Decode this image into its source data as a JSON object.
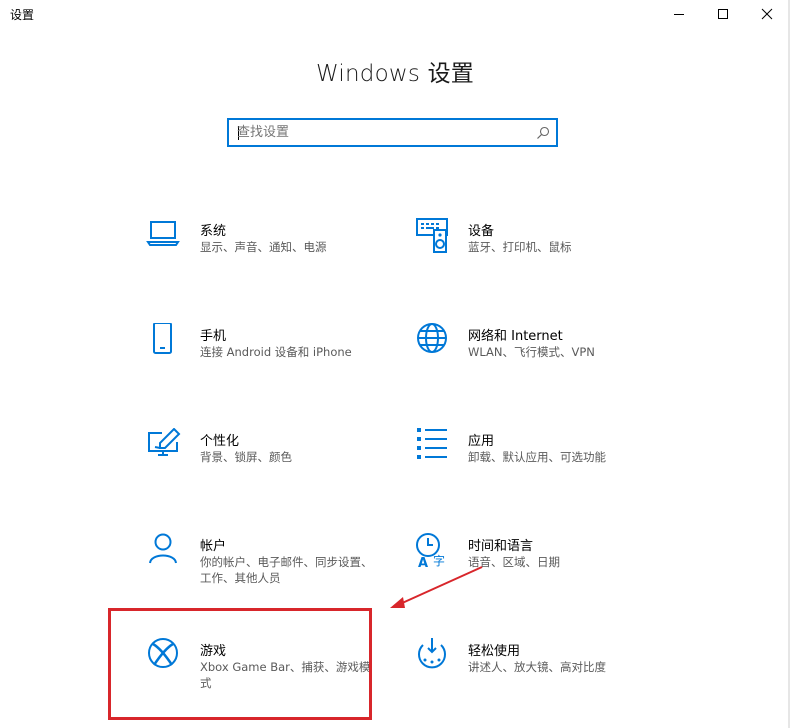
{
  "window": {
    "title": "设置",
    "minimize_icon": "minimize-icon",
    "maximize_icon": "maximize-icon",
    "close_icon": "close-icon"
  },
  "header": {
    "title": "Windows 设置"
  },
  "search": {
    "placeholder": "查找设置",
    "value": "",
    "icon": "search-icon"
  },
  "categories": [
    {
      "name": "系统",
      "desc": "显示、声音、通知、电源",
      "icon": "laptop-icon"
    },
    {
      "name": "设备",
      "desc": "蓝牙、打印机、鼠标",
      "icon": "keyboard-speaker-icon"
    },
    {
      "name": "手机",
      "desc": "连接 Android 设备和 iPhone",
      "icon": "phone-icon"
    },
    {
      "name": "网络和 Internet",
      "desc": "WLAN、飞行模式、VPN",
      "icon": "globe-icon"
    },
    {
      "name": "个性化",
      "desc": "背景、锁屏、颜色",
      "icon": "paint-screen-icon"
    },
    {
      "name": "应用",
      "desc": "卸载、默认应用、可选功能",
      "icon": "apps-list-icon"
    },
    {
      "name": "帐户",
      "desc": "你的帐户、电子邮件、同步设置、工作、其他人员",
      "icon": "person-icon"
    },
    {
      "name": "时间和语言",
      "desc": "语音、区域、日期",
      "icon": "time-language-icon"
    },
    {
      "name": "游戏",
      "desc": "Xbox Game Bar、捕获、游戏模式",
      "icon": "xbox-icon"
    },
    {
      "name": "轻松使用",
      "desc": "讲述人、放大镜、高对比度",
      "icon": "ease-of-access-icon"
    }
  ],
  "colors": {
    "accent": "#0078d7",
    "annotation": "#d8262b"
  }
}
